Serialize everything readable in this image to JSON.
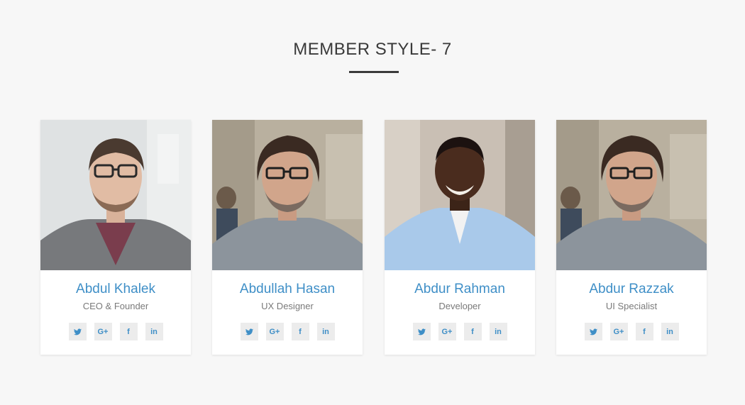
{
  "section": {
    "title": "MEMBER STYLE- 7"
  },
  "colors": {
    "accent": "#3f8fc7",
    "title": "#3a3a3a",
    "background": "#f7f7f7",
    "social_bg": "#ececec"
  },
  "members": [
    {
      "name": "Abdul Khalek",
      "role": "CEO & Founder",
      "socials": [
        "twitter-icon",
        "google-plus-icon",
        "facebook-icon",
        "linkedin-icon"
      ]
    },
    {
      "name": "Abdullah Hasan",
      "role": "UX Designer",
      "socials": [
        "twitter-icon",
        "google-plus-icon",
        "facebook-icon",
        "linkedin-icon"
      ]
    },
    {
      "name": "Abdur Rahman",
      "role": "Developer",
      "socials": [
        "twitter-icon",
        "google-plus-icon",
        "facebook-icon",
        "linkedin-icon"
      ]
    },
    {
      "name": "Abdur Razzak",
      "role": "UI Specialist",
      "socials": [
        "twitter-icon",
        "google-plus-icon",
        "facebook-icon",
        "linkedin-icon"
      ]
    }
  ]
}
